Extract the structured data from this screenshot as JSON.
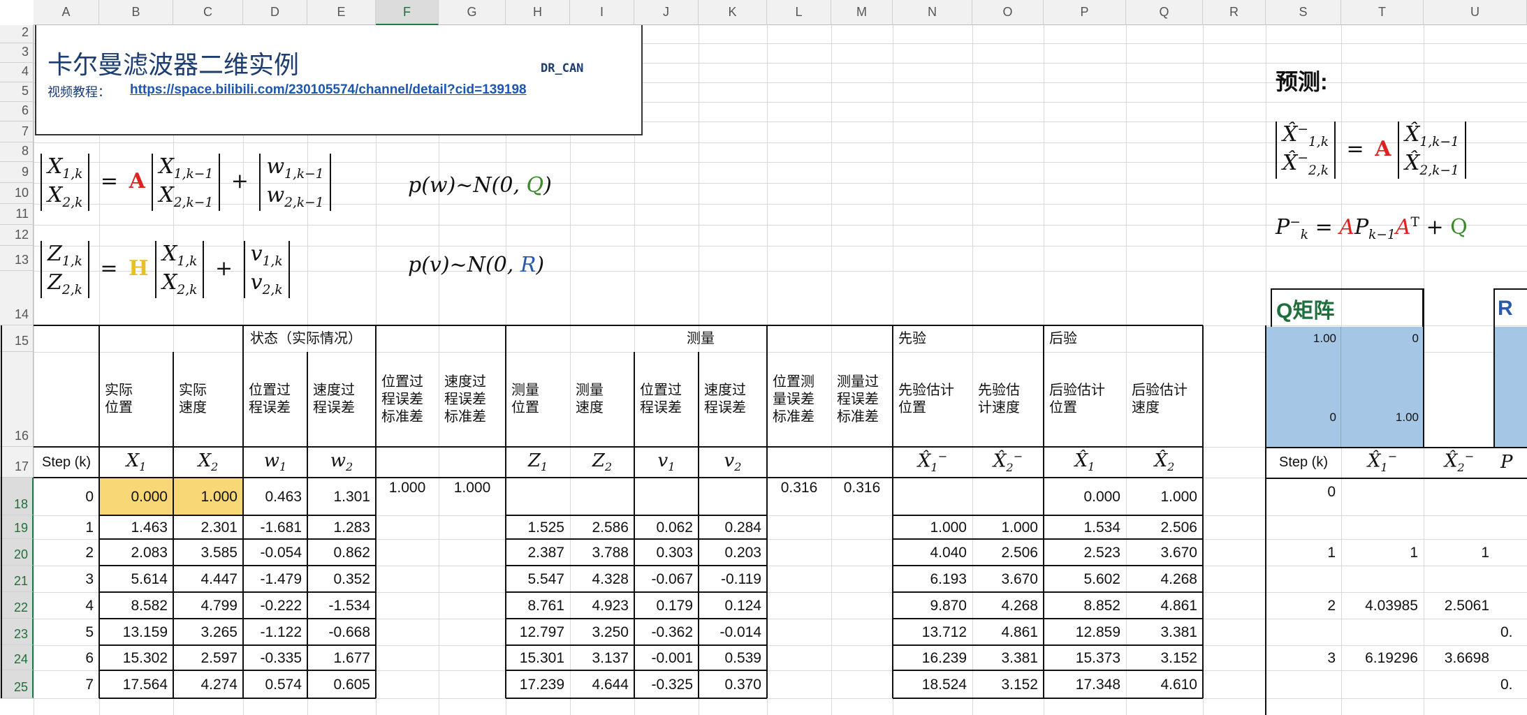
{
  "column_headers": [
    "A",
    "B",
    "C",
    "D",
    "E",
    "F",
    "G",
    "H",
    "I",
    "J",
    "K",
    "L",
    "M",
    "N",
    "O",
    "P",
    "Q",
    "R",
    "S",
    "T",
    "U"
  ],
  "selected_column": "F",
  "row_headers": [
    "2",
    "3",
    "4",
    "5",
    "6",
    "7",
    "8",
    "9",
    "10",
    "11",
    "12",
    "13",
    "14",
    "15",
    "16",
    "17",
    "18",
    "19",
    "20",
    "21",
    "22",
    "23",
    "24",
    "25"
  ],
  "selected_rows": [
    "18",
    "19",
    "20",
    "21",
    "22",
    "23",
    "24",
    "25"
  ],
  "title": {
    "main": "卡尔曼滤波器二维实例",
    "author": "DR_CAN",
    "tutorial_label": "视频教程：",
    "tutorial_link": "https://space.bilibili.com/230105574/channel/detail?cid=139198"
  },
  "prediction": {
    "heading": "预测:"
  },
  "q_matrix": {
    "title": "Q矩阵",
    "cells": [
      "1.00",
      "0",
      "0",
      "1.00"
    ],
    "partial_next": "R"
  },
  "table": {
    "group_headers": {
      "state": "状态（实际情况）",
      "measure": "测量",
      "prior": "先验",
      "posterior": "后验"
    },
    "col_labels": [
      "实际\n位置",
      "实际\n速度",
      "位置过\n程误差",
      "速度过\n程误差",
      "位置过\n程误差\n标准差",
      "速度过\n程误差\n标准差",
      "测量\n位置",
      "测量\n速度",
      "位置过\n程误差",
      "速度过\n程误差",
      "位置测\n量误差\n标准差",
      "测量过\n程误差\n标准差",
      "先验估计\n位置",
      "先验估\n计速度",
      "后验估计\n位置",
      "后验估计\n速度"
    ],
    "step_label": "Step (k)",
    "std_values": {
      "F": "1.000",
      "G": "1.000",
      "L": "0.316",
      "M": "0.316"
    },
    "rows": [
      {
        "k": "0",
        "X1": "0.000",
        "X2": "1.000",
        "w1": "0.463",
        "w2": "1.301",
        "Z1": "",
        "Z2": "",
        "v1": "",
        "v2": "",
        "pX1": "",
        "pX2": "",
        "X1h": "0.000",
        "X2h": "1.000"
      },
      {
        "k": "1",
        "X1": "1.463",
        "X2": "2.301",
        "w1": "-1.681",
        "w2": "1.283",
        "Z1": "1.525",
        "Z2": "2.586",
        "v1": "0.062",
        "v2": "0.284",
        "pX1": "1.000",
        "pX2": "1.000",
        "X1h": "1.534",
        "X2h": "2.506"
      },
      {
        "k": "2",
        "X1": "2.083",
        "X2": "3.585",
        "w1": "-0.054",
        "w2": "0.862",
        "Z1": "2.387",
        "Z2": "3.788",
        "v1": "0.303",
        "v2": "0.203",
        "pX1": "4.040",
        "pX2": "2.506",
        "X1h": "2.523",
        "X2h": "3.670"
      },
      {
        "k": "3",
        "X1": "5.614",
        "X2": "4.447",
        "w1": "-1.479",
        "w2": "0.352",
        "Z1": "5.547",
        "Z2": "4.328",
        "v1": "-0.067",
        "v2": "-0.119",
        "pX1": "6.193",
        "pX2": "3.670",
        "X1h": "5.602",
        "X2h": "4.268"
      },
      {
        "k": "4",
        "X1": "8.582",
        "X2": "4.799",
        "w1": "-0.222",
        "w2": "-1.534",
        "Z1": "8.761",
        "Z2": "4.923",
        "v1": "0.179",
        "v2": "0.124",
        "pX1": "9.870",
        "pX2": "4.268",
        "X1h": "8.852",
        "X2h": "4.861"
      },
      {
        "k": "5",
        "X1": "13.159",
        "X2": "3.265",
        "w1": "-1.122",
        "w2": "-0.668",
        "Z1": "12.797",
        "Z2": "3.250",
        "v1": "-0.362",
        "v2": "-0.014",
        "pX1": "13.712",
        "pX2": "4.861",
        "X1h": "12.859",
        "X2h": "3.381"
      },
      {
        "k": "6",
        "X1": "15.302",
        "X2": "2.597",
        "w1": "-0.335",
        "w2": "1.677",
        "Z1": "15.301",
        "Z2": "3.137",
        "v1": "-0.001",
        "v2": "0.539",
        "pX1": "16.239",
        "pX2": "3.381",
        "X1h": "15.373",
        "X2h": "3.152"
      },
      {
        "k": "7",
        "X1": "17.564",
        "X2": "4.274",
        "w1": "0.574",
        "w2": "0.605",
        "Z1": "17.239",
        "Z2": "4.644",
        "v1": "-0.325",
        "v2": "0.370",
        "pX1": "18.524",
        "pX2": "3.152",
        "X1h": "17.348",
        "X2h": "4.610"
      }
    ]
  },
  "right_table": {
    "step_label": "Step (k)",
    "rows": [
      {
        "k": "0",
        "a": "",
        "b": ""
      },
      {
        "k": "1",
        "a": "1",
        "b": "1"
      },
      {
        "k": "2",
        "a": "4.03985",
        "b": "2.5061"
      },
      {
        "k": "3",
        "a": "6.19296",
        "b": "3.6698"
      }
    ],
    "partial_cells": [
      "0.",
      "0."
    ]
  }
}
